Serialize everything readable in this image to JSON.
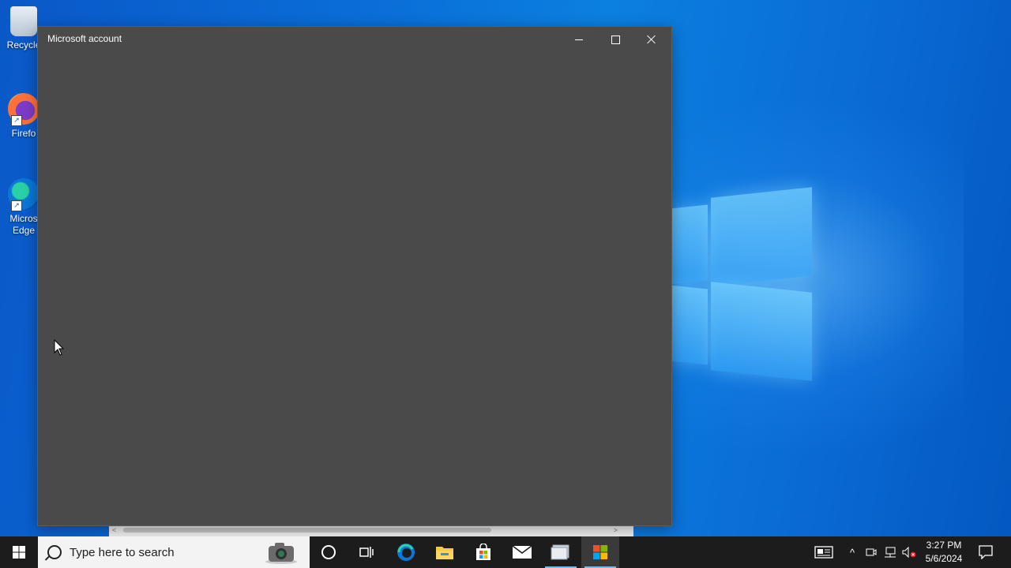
{
  "desktop": {
    "icons": [
      {
        "label": "Recycle",
        "icon": "recycle-bin-icon"
      },
      {
        "label": "Firefo",
        "icon": "firefox-icon"
      },
      {
        "label": "Micros",
        "label2": "Edge",
        "icon": "edge-icon"
      }
    ]
  },
  "window": {
    "title": "Microsoft account",
    "background": "#4a4a4a"
  },
  "taskbar": {
    "search_placeholder": "Type here to search",
    "apps": [
      "cortana-icon",
      "task-view-icon",
      "edge-icon",
      "file-explorer-icon",
      "store-icon",
      "mail-icon",
      "photos-icon",
      "microsoft-store-running-icon"
    ],
    "clock": {
      "time": "3:27 PM",
      "date": "5/6/2024"
    }
  },
  "colors": {
    "taskbar": "#1c1c1c",
    "desktop_blue": "#0a6fd8",
    "active_indicator": "#76b9ed"
  }
}
